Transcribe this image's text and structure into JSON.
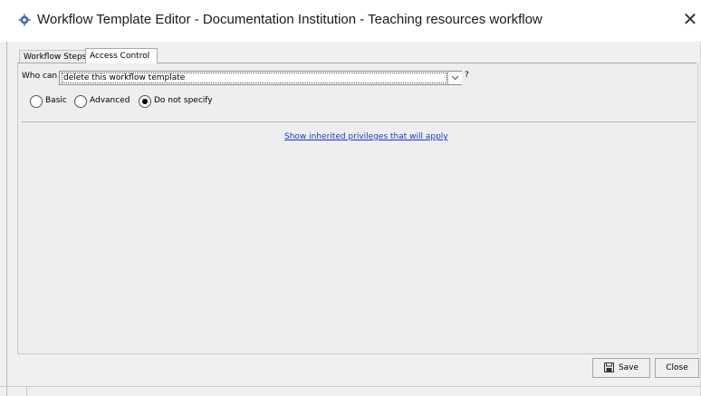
{
  "window": {
    "title": "Workflow Template Editor - Documentation Institution - Teaching resources workflow",
    "app_icon": "gear-icon",
    "close_glyph": "✕"
  },
  "tabs": [
    {
      "label": "Workflow Steps",
      "active": false
    },
    {
      "label": "Access Control",
      "active": true
    }
  ],
  "access": {
    "who_can_label": "Who can",
    "action_value": "delete this workflow template",
    "help_glyph": "?",
    "radio_options": [
      {
        "label": "Basic",
        "selected": false
      },
      {
        "label": "Advanced",
        "selected": false
      },
      {
        "label": "Do not specify",
        "selected": true
      }
    ],
    "inherited_link": "Show inherited privileges that will apply"
  },
  "footer": {
    "save_label": "Save",
    "close_label": "Close"
  },
  "colors": {
    "link": "#1a36d8",
    "background": "#f0f0f0"
  }
}
